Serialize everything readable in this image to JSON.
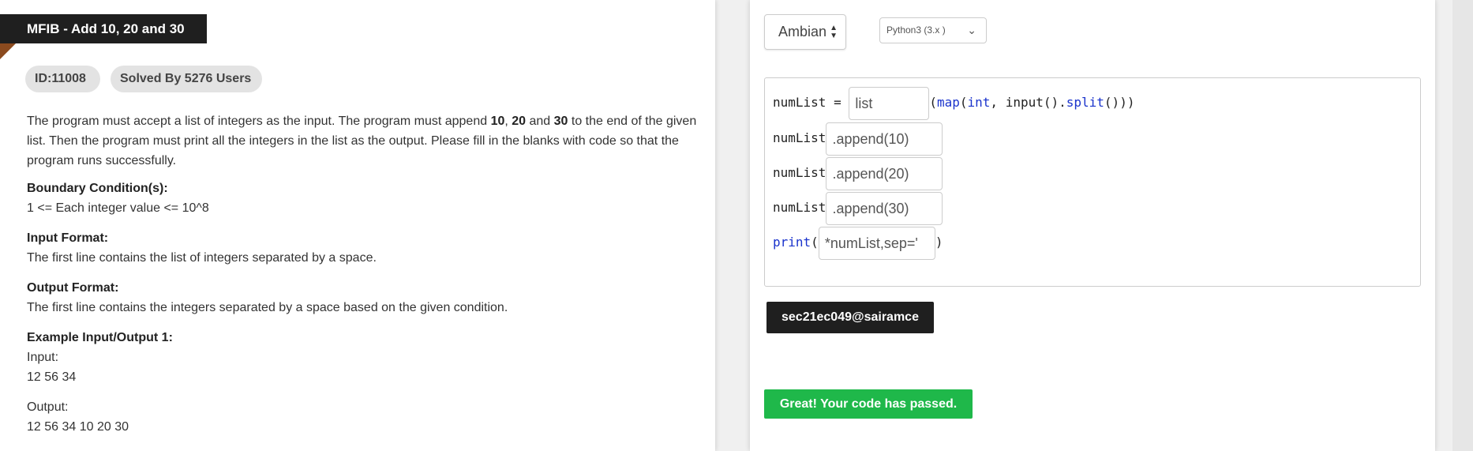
{
  "problem": {
    "title": "MFIB - Add 10, 20 and 30",
    "id_badge": "ID:11008",
    "solved_badge": "Solved By 5276 Users",
    "description": {
      "part1": "The program must accept a list of integers as the input. The program must append ",
      "n10": "10",
      "comma1": ", ",
      "n20": "20",
      "and": " and ",
      "n30": "30",
      "part2": " to the end of the given list. Then the program must print all the integers in the list as the output. Please fill in the blanks with code so that the program runs successfully."
    },
    "boundary_title": "Boundary Condition(s):",
    "boundary_text": "1 <= Each integer value <= 10^8",
    "input_title": "Input Format:",
    "input_text": "The first line contains the list of integers separated by a space.",
    "output_title": "Output Format:",
    "output_text": "The first line contains the integers separated by a space based on the given condition.",
    "example_title": "Example Input/Output 1:",
    "example_input_label": "Input:",
    "example_input_value": "12 56 34",
    "example_output_label": "Output:",
    "example_output_value": "12 56 34 10 20 30"
  },
  "editor": {
    "theme_select": "Ambian",
    "language_select": "Python3 (3.x )",
    "lines": [
      {
        "prefix": "numList = ",
        "blank": "list",
        "suffix_parts": [
          "(",
          "map",
          "(",
          "int",
          ", input().",
          "split",
          "()))"
        ]
      },
      {
        "prefix": "numList",
        "blank": ".append(10)"
      },
      {
        "prefix": "numList",
        "blank": ".append(20)"
      },
      {
        "prefix": "numList",
        "blank": ".append(30)"
      },
      {
        "prefix": "print",
        "open": "(",
        "blank": "*numList,sep='",
        "close": ")"
      }
    ],
    "user": "sec21ec049@sairamce",
    "result_message": "Great! Your code has passed."
  },
  "colors": {
    "accent_dark": "#1f1f1f",
    "success": "#1fb84a",
    "keyword": "#1a33cc"
  }
}
